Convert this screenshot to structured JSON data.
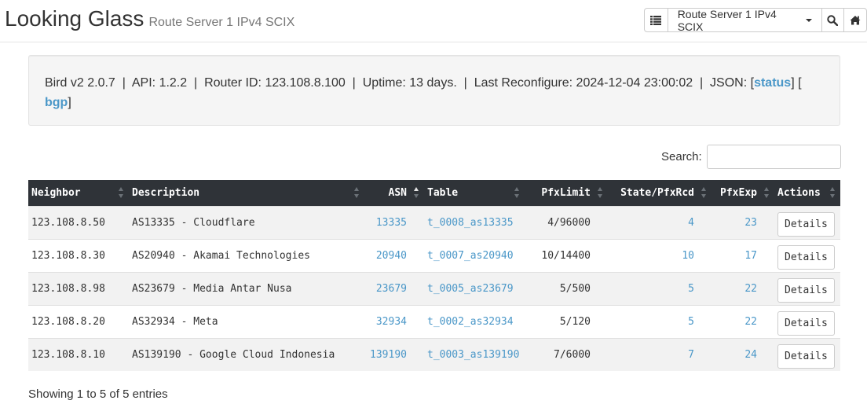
{
  "header": {
    "title": "Looking Glass",
    "subtitle": "Route Server 1 IPv4 SCIX",
    "selector_label": "Route Server 1 IPv4 SCIX",
    "icons": [
      "list-icon",
      "caret-down-icon",
      "search-icon",
      "home-icon"
    ]
  },
  "info": {
    "line": "Bird v2 2.0.7  |  API: 1.2.2  |  Router ID: 123.108.8.100  |  Uptime: 13 days.  |  Last Reconfigure: 2024-12-04 23:00:02  |  JSON: [",
    "status_link": "status",
    "between": "] [",
    "bgp_link": "bgp",
    "end": "]"
  },
  "search": {
    "label": "Search:",
    "value": ""
  },
  "table": {
    "headers": [
      "Neighbor",
      "Description",
      "ASN",
      "Table",
      "PfxLimit",
      "State/PfxRcd",
      "PfxExp",
      "Actions"
    ],
    "rows": [
      {
        "neighbor": "123.108.8.50",
        "description": "AS13335 - Cloudflare",
        "asn": "13335",
        "table": "t_0008_as13335",
        "pfxlimit": "4/96000",
        "state": "4",
        "pfxexp": "23",
        "action": "Details"
      },
      {
        "neighbor": "123.108.8.30",
        "description": "AS20940 - Akamai Technologies",
        "asn": "20940",
        "table": "t_0007_as20940",
        "pfxlimit": "10/14400",
        "state": "10",
        "pfxexp": "17",
        "action": "Details"
      },
      {
        "neighbor": "123.108.8.98",
        "description": "AS23679 - Media Antar Nusa",
        "asn": "23679",
        "table": "t_0005_as23679",
        "pfxlimit": "5/500",
        "state": "5",
        "pfxexp": "22",
        "action": "Details"
      },
      {
        "neighbor": "123.108.8.20",
        "description": "AS32934 - Meta",
        "asn": "32934",
        "table": "t_0002_as32934",
        "pfxlimit": "5/120",
        "state": "5",
        "pfxexp": "22",
        "action": "Details"
      },
      {
        "neighbor": "123.108.8.10",
        "description": "AS139190 - Google Cloud Indonesia",
        "asn": "139190",
        "table": "t_0003_as139190",
        "pfxlimit": "7/6000",
        "state": "7",
        "pfxexp": "24",
        "action": "Details"
      }
    ]
  },
  "footer": {
    "info": "Showing 1 to 5 of 5 entries"
  },
  "colors": {
    "link": "#4a97c8",
    "header_bg": "#2f3338",
    "well_bg": "#f5f5f5"
  }
}
